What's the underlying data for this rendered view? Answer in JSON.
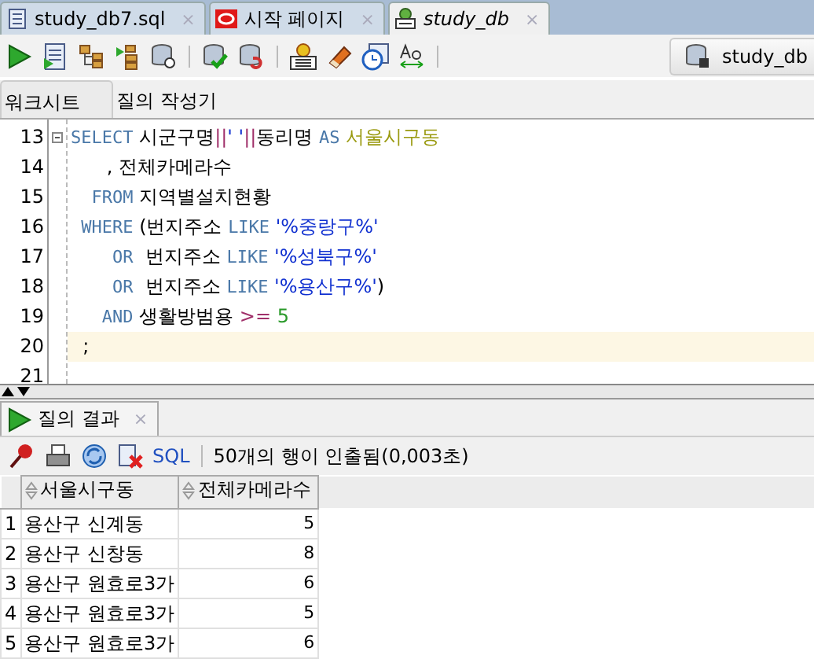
{
  "file_tabs": [
    {
      "label": "study_db7.sql",
      "selected": false,
      "close": "×"
    },
    {
      "label": "시작 페이지",
      "selected": false,
      "close": "×"
    },
    {
      "label": "study_db",
      "selected": true,
      "close": "×"
    }
  ],
  "toolbar": {
    "connection": "study_db"
  },
  "sub_tabs": [
    {
      "label": "워크시트",
      "selected": true
    },
    {
      "label": "질의 작성기",
      "selected": false
    }
  ],
  "editor": {
    "lines": [
      {
        "number": "13",
        "fold": true,
        "highlighted": false,
        "tokens": [
          {
            "kind": "keyword",
            "text": "SELECT"
          },
          {
            "kind": "plain",
            "text": " 시군구명"
          },
          {
            "kind": "op",
            "text": "||"
          },
          {
            "kind": "string",
            "text": "' '"
          },
          {
            "kind": "op",
            "text": "||"
          },
          {
            "kind": "plain",
            "text": "동리명 "
          },
          {
            "kind": "keyword",
            "text": "AS"
          },
          {
            "kind": "alias",
            "text": " 서울시구동"
          }
        ]
      },
      {
        "number": "14",
        "fold": false,
        "highlighted": false,
        "tokens": [
          {
            "kind": "plain",
            "text": "      , 전체카메라수"
          }
        ]
      },
      {
        "number": "15",
        "fold": false,
        "highlighted": false,
        "tokens": [
          {
            "kind": "keyword",
            "text": "  FROM"
          },
          {
            "kind": "plain",
            "text": " 지역별설치현황"
          }
        ]
      },
      {
        "number": "16",
        "fold": false,
        "highlighted": false,
        "tokens": [
          {
            "kind": "keyword",
            "text": " WHERE"
          },
          {
            "kind": "plain",
            "text": " (번지주소 "
          },
          {
            "kind": "keyword",
            "text": "LIKE"
          },
          {
            "kind": "string",
            "text": " '%중랑구%'"
          }
        ]
      },
      {
        "number": "17",
        "fold": false,
        "highlighted": false,
        "tokens": [
          {
            "kind": "keyword",
            "text": "    OR"
          },
          {
            "kind": "plain",
            "text": "  번지주소 "
          },
          {
            "kind": "keyword",
            "text": "LIKE"
          },
          {
            "kind": "string",
            "text": " '%성북구%'"
          }
        ]
      },
      {
        "number": "18",
        "fold": false,
        "highlighted": false,
        "tokens": [
          {
            "kind": "keyword",
            "text": "    OR"
          },
          {
            "kind": "plain",
            "text": "  번지주소 "
          },
          {
            "kind": "keyword",
            "text": "LIKE"
          },
          {
            "kind": "string",
            "text": " '%용산구%'"
          },
          {
            "kind": "plain",
            "text": ")"
          }
        ]
      },
      {
        "number": "19",
        "fold": false,
        "highlighted": false,
        "tokens": [
          {
            "kind": "keyword",
            "text": "   AND"
          },
          {
            "kind": "plain",
            "text": " 생활방범용 "
          },
          {
            "kind": "op",
            "text": ">="
          },
          {
            "kind": "number",
            "text": " 5"
          }
        ]
      },
      {
        "number": "20",
        "fold": false,
        "highlighted": true,
        "tokens": [
          {
            "kind": "plain",
            "text": "  ;"
          }
        ]
      },
      {
        "number": "21",
        "fold": false,
        "highlighted": false
      }
    ]
  },
  "results": {
    "tab": {
      "label": "질의 결과",
      "close": "×"
    },
    "toolbar": {
      "sql_link": "SQL",
      "status": "50개의 행이 인출됨(0,003초)"
    },
    "columns": [
      "서울시구동",
      "전체카메라수"
    ],
    "rows": [
      {
        "number": "1",
        "cells": [
          "용산구 신계동",
          "5"
        ]
      },
      {
        "number": "2",
        "cells": [
          "용산구 신창동",
          "8"
        ]
      },
      {
        "number": "3",
        "cells": [
          "용산구 원효로3가",
          "6"
        ]
      },
      {
        "number": "4",
        "cells": [
          "용산구 원효로3가",
          "5"
        ]
      },
      {
        "number": "5",
        "cells": [
          "용산구 원효로3가",
          "6"
        ]
      }
    ]
  }
}
